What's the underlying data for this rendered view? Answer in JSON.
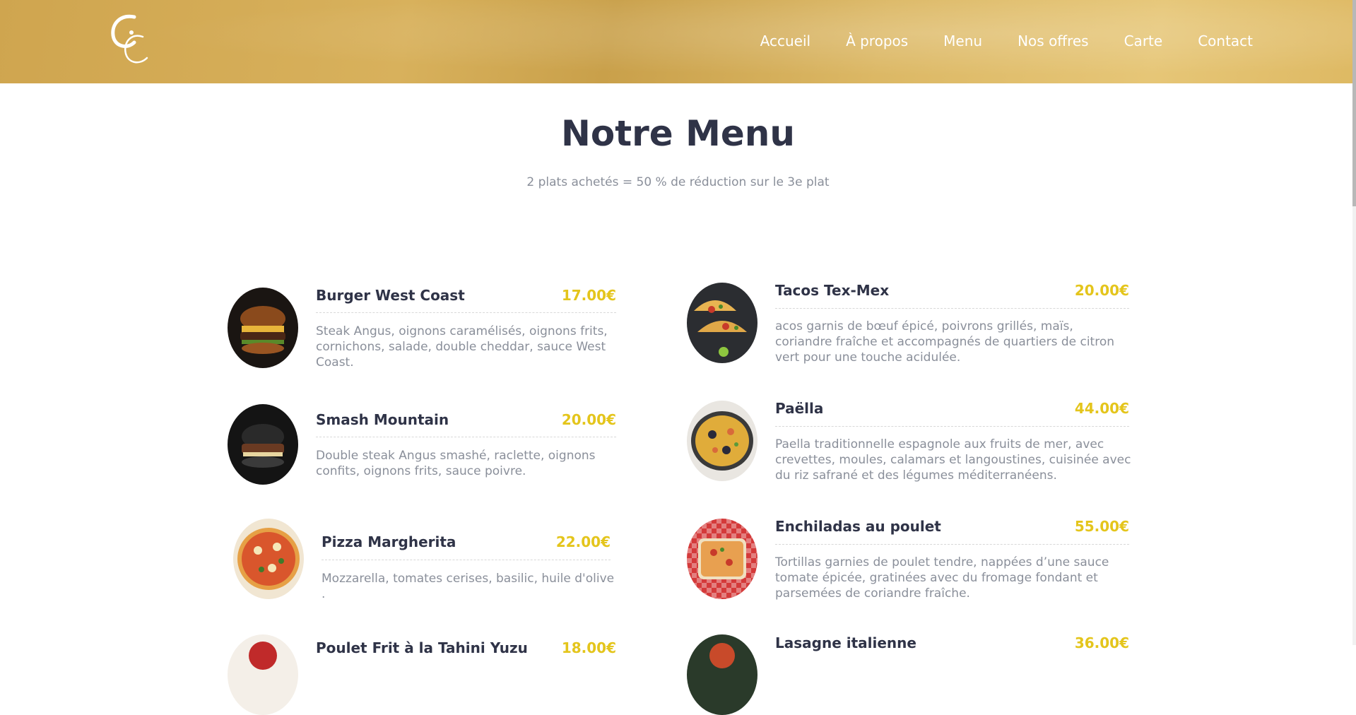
{
  "nav": {
    "items": [
      "Accueil",
      "À propos",
      "Menu",
      "Nos offres",
      "Carte",
      "Contact"
    ]
  },
  "colors": {
    "header_gold": "#d4ad58",
    "price_yellow": "#e4c51c",
    "title_dark": "#2f3347",
    "desc_gray": "#8a8f9a"
  },
  "page": {
    "title": "Notre Menu",
    "subtitle": "2 plats achetés = 50 % de réduction sur le 3e plat"
  },
  "menu": {
    "left": [
      {
        "name": "Burger West Coast",
        "price": "17.00€",
        "desc": "Steak Angus, oignons caramélisés, oignons frits, cornichons, salade, double cheddar, sauce West Coast.",
        "icon": "burger-image"
      },
      {
        "name": "Smash Mountain",
        "price": "20.00€",
        "desc": "Double steak Angus smashé, raclette, oignons confits, oignons frits, sauce poivre.",
        "icon": "smash-burger-image"
      },
      {
        "name": "Pizza Margherita",
        "price": "22.00€",
        "desc": "Mozzarella, tomates cerises, basilic, huile d'olive .",
        "icon": "pizza-image"
      },
      {
        "name": "Poulet Frit à la Tahini Yuzu",
        "price": "18.00€",
        "desc": "",
        "icon": "dish-image"
      }
    ],
    "right": [
      {
        "name": "Tacos Tex-Mex",
        "price": "20.00€",
        "desc": "acos garnis de bœuf épicé, poivrons grillés, maïs, coriandre fraîche et accompagnés de quartiers de citron vert pour une touche acidulée.",
        "icon": "tacos-image"
      },
      {
        "name": "Paëlla",
        "price": "44.00€",
        "desc": "Paella traditionnelle espagnole aux fruits de mer, avec crevettes, moules, calamars et langoustines, cuisinée avec du riz safrané et des légumes méditerranéens.",
        "icon": "paella-image"
      },
      {
        "name": "Enchiladas au poulet",
        "price": "55.00€",
        "desc": "Tortillas garnies de poulet tendre, nappées d’une sauce tomate épicée, gratinées avec du fromage fondant et parsemées de coriandre fraîche.",
        "icon": "enchiladas-image"
      },
      {
        "name": "Lasagne italienne",
        "price": "36.00€",
        "desc": "",
        "icon": "lasagne-image"
      }
    ]
  }
}
